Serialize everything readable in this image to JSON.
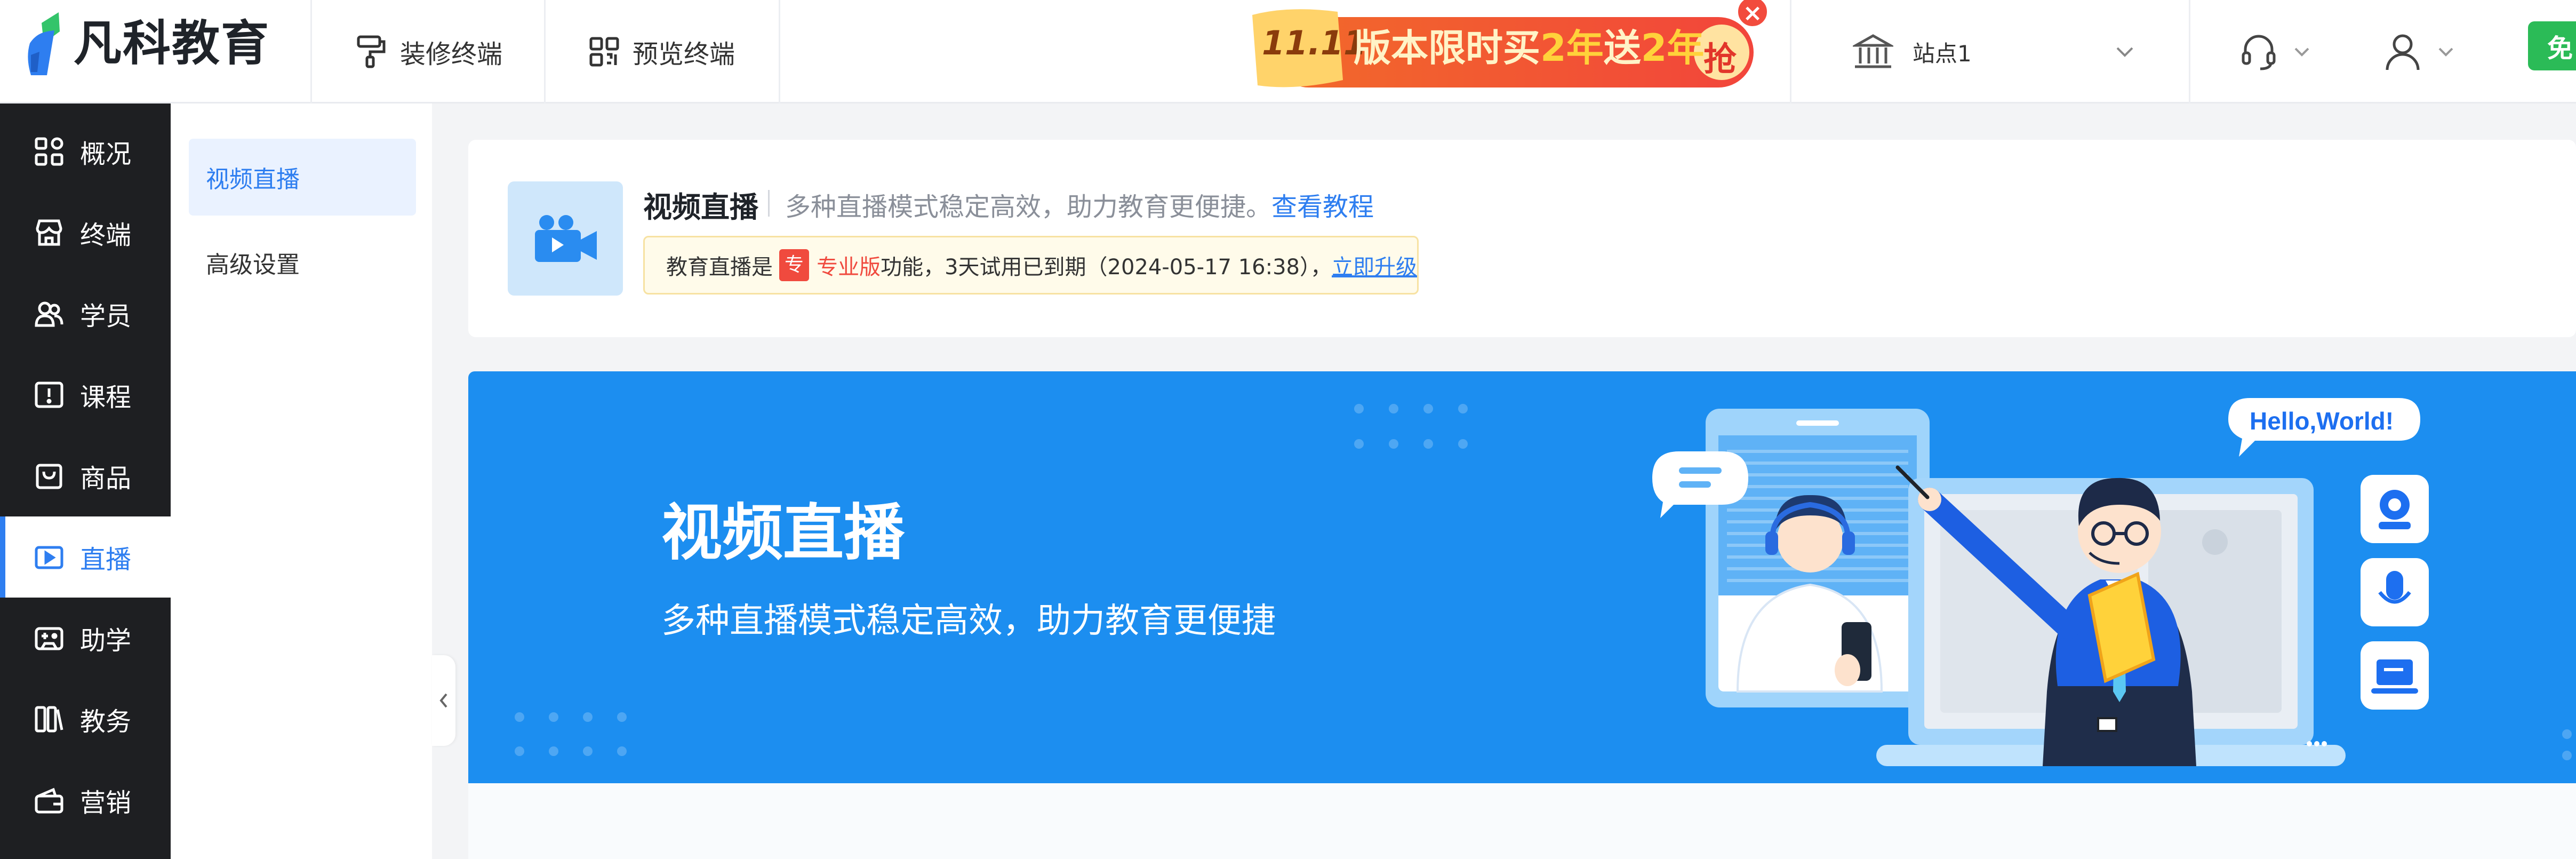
{
  "topbar": {
    "brand_name": "凡科教育",
    "decorate_terminal": "装修终端",
    "preview_terminal": "预览终端",
    "promo": {
      "badge": "11.11",
      "text_prefix": "版本限时买",
      "highlight1": "2年",
      "text_mid": "送",
      "highlight2": "2年",
      "grab": "抢",
      "close": "×"
    },
    "site_select": "站点1",
    "trial_button": "免"
  },
  "leftnav": {
    "items": [
      {
        "label": "概况",
        "icon": "dashboard-icon"
      },
      {
        "label": "终端",
        "icon": "store-icon"
      },
      {
        "label": "学员",
        "icon": "users-icon"
      },
      {
        "label": "课程",
        "icon": "course-icon"
      },
      {
        "label": "商品",
        "icon": "shopping-bag-icon"
      },
      {
        "label": "直播",
        "icon": "live-video-icon",
        "active": true
      },
      {
        "label": "助学",
        "icon": "game-controller-icon"
      },
      {
        "label": "教务",
        "icon": "books-icon"
      },
      {
        "label": "营销",
        "icon": "wallet-icon"
      }
    ]
  },
  "subnav": {
    "items": [
      {
        "label": "视频直播",
        "active": true
      },
      {
        "label": "高级设置"
      }
    ]
  },
  "intro": {
    "title": "视频直播",
    "desc": "多种直播模式稳定高效，助力教育更便捷。",
    "tutorial_link": "查看教程",
    "notice_prefix": "教育直播是",
    "pro_badge": "专",
    "pro_text": "专业版",
    "notice_suffix": "功能，3天试用已到期（2024-05-17 16:38），",
    "upgrade_link": "立即升级"
  },
  "banner": {
    "title": "视频直播",
    "subtitle": "多种直播模式稳定高效，助力教育更便捷",
    "bubble_text": "Hello,World!"
  },
  "colors": {
    "accent": "#2e7ef0",
    "sidebar_bg": "#1e1f22",
    "banner_bg": "#1c8ef0",
    "promo_red": "#f24b3d",
    "trial_green": "#2bbb57"
  }
}
